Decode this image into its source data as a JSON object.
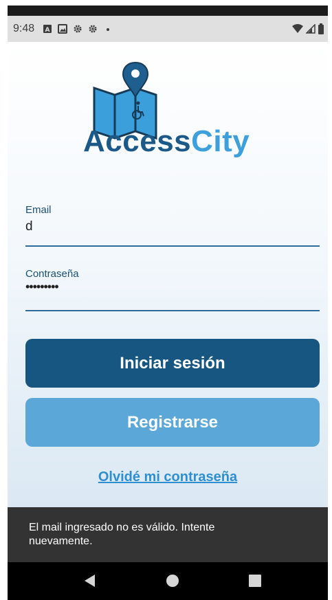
{
  "status_bar": {
    "time": "9:48",
    "icons": [
      "a-notification-icon",
      "image-notification-icon",
      "settings-icon",
      "settings-icon",
      "dot-icon"
    ],
    "right_icons": [
      "wifi-icon",
      "signal-icon",
      "battery-icon"
    ]
  },
  "brand": {
    "part1": "Access",
    "part2": "City",
    "color_primary": "#1b5a88",
    "color_accent": "#3da0dc"
  },
  "form": {
    "email": {
      "label": "Email",
      "value": "d"
    },
    "password": {
      "label": "Contraseña",
      "value": "•••••••••"
    }
  },
  "buttons": {
    "login": "Iniciar sesión",
    "register": "Registrarse",
    "forgot": "Olvidé mi contraseña"
  },
  "snackbar": {
    "message": "El mail ingresado no es válido. Intente nuevamente."
  },
  "nav": {
    "back": "back-icon",
    "home": "home-icon",
    "recents": "recents-icon"
  }
}
